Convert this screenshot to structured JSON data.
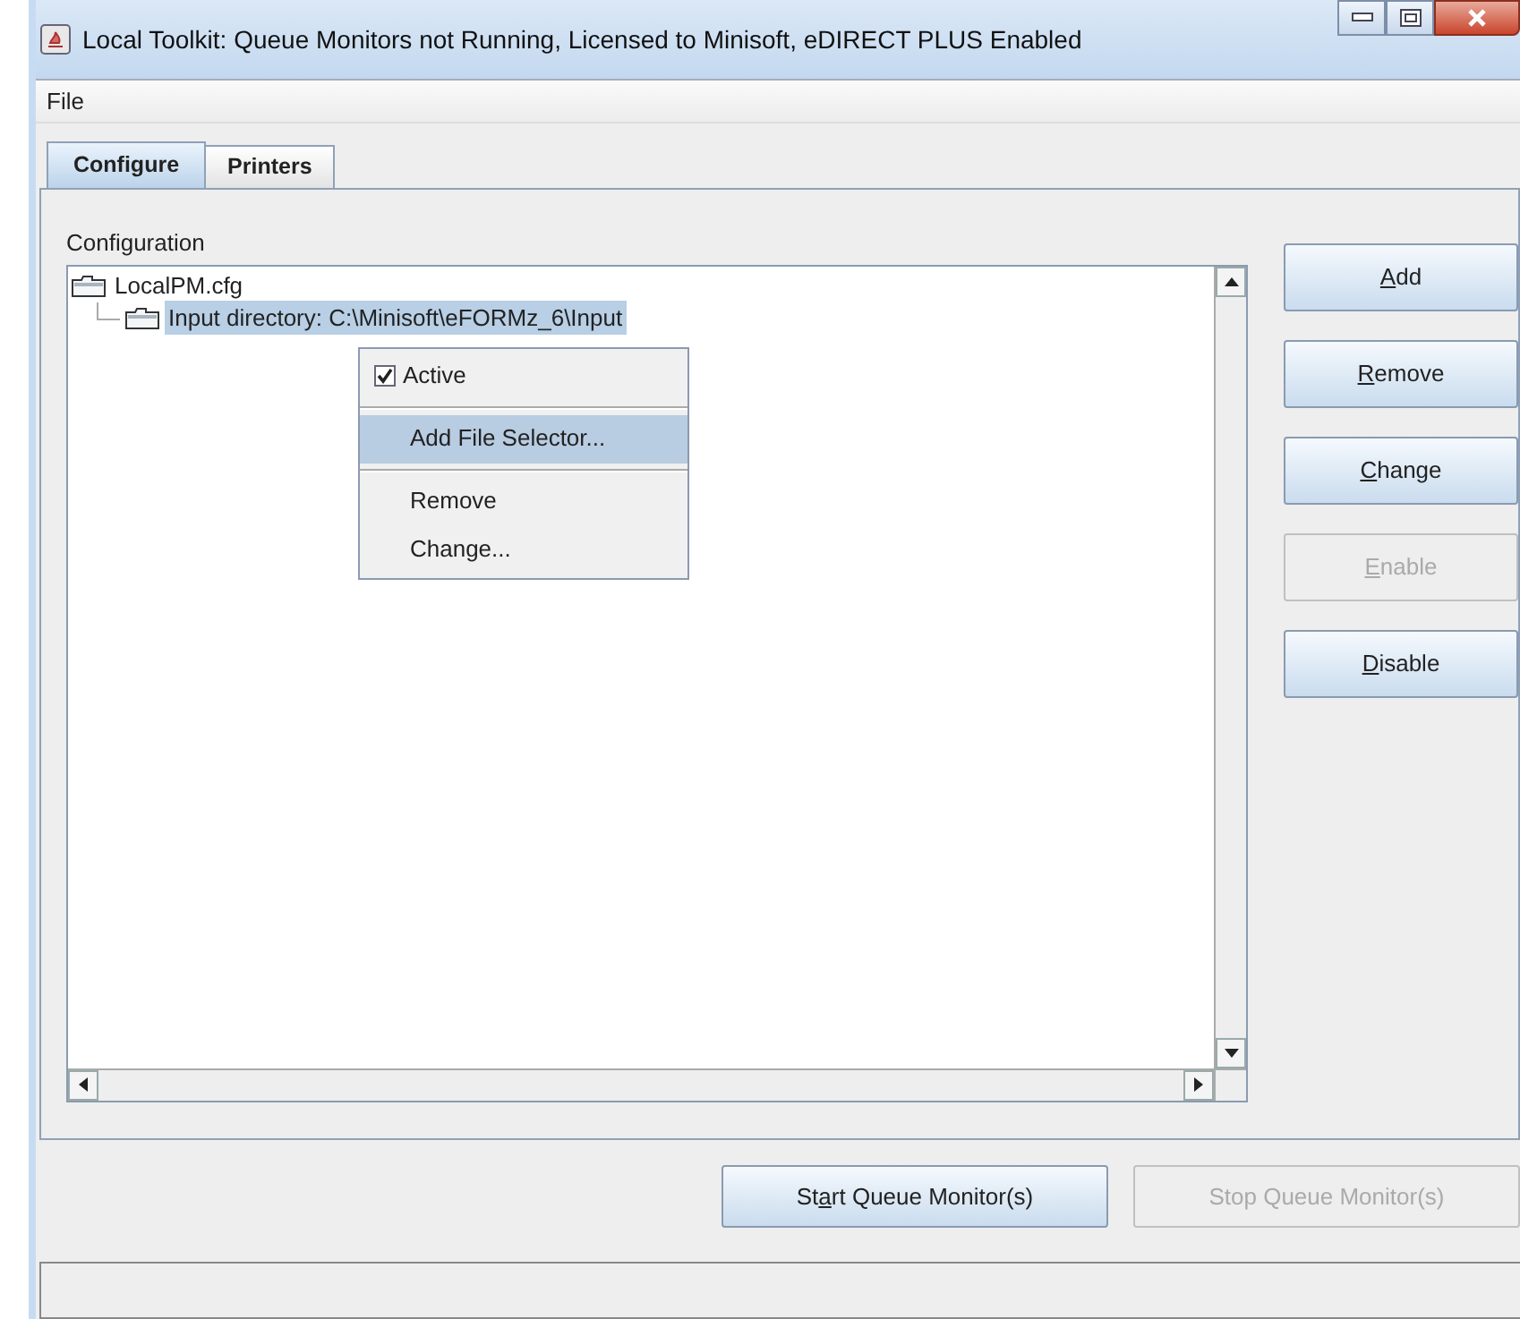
{
  "window": {
    "title": "Local Toolkit: Queue Monitors not Running, Licensed to Minisoft, eDIRECT PLUS Enabled"
  },
  "menu": [
    "File"
  ],
  "tabs": [
    {
      "label": "Configure",
      "selected": true
    },
    {
      "label": "Printers",
      "selected": false
    }
  ],
  "configuration": {
    "label": "Configuration",
    "tree": [
      {
        "label": "LocalPM.cfg",
        "selected": false,
        "children": [
          {
            "label": "Input directory: C:\\Minisoft\\eFORMz_6\\Input",
            "selected": true
          }
        ]
      }
    ]
  },
  "context_menu": [
    {
      "kind": "check",
      "label": "Active",
      "checked": true,
      "selected": false
    },
    {
      "kind": "separator"
    },
    {
      "kind": "item",
      "label": "Add File Selector...",
      "selected": true
    },
    {
      "kind": "separator"
    },
    {
      "kind": "item",
      "label": "Remove",
      "selected": false
    },
    {
      "kind": "item",
      "label": "Change...",
      "selected": false
    }
  ],
  "side_buttons": [
    {
      "key": "A",
      "post": "dd",
      "disabled": false
    },
    {
      "key": "R",
      "post": "emove",
      "disabled": false
    },
    {
      "key": "C",
      "post": "hange",
      "disabled": false
    },
    {
      "key": "E",
      "post": "nable",
      "disabled": true
    },
    {
      "key": "D",
      "post": "isable",
      "disabled": false
    }
  ],
  "bottom_buttons": [
    {
      "pre": "St",
      "key": "a",
      "post": "rt Queue Monitor(s)",
      "disabled": false
    },
    {
      "pre": "Stop Queue Monitor(s)",
      "disabled": true
    }
  ]
}
